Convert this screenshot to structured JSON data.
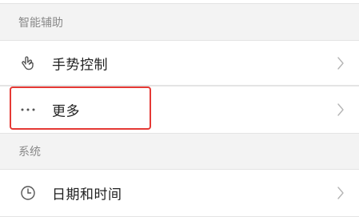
{
  "sections": {
    "smart_assist": {
      "title": "智能辅助",
      "items": {
        "gesture": {
          "label": "手势控制",
          "icon": "hand-gesture-icon"
        },
        "more": {
          "label": "更多",
          "icon": "more-dots-icon"
        }
      }
    },
    "system": {
      "title": "系统",
      "items": {
        "datetime": {
          "label": "日期和时间",
          "icon": "clock-icon"
        }
      }
    }
  },
  "colors": {
    "highlight": "#e53935",
    "section_text": "#8a8a8a",
    "row_background": "#ffffff",
    "page_background": "#f3f3f3"
  }
}
